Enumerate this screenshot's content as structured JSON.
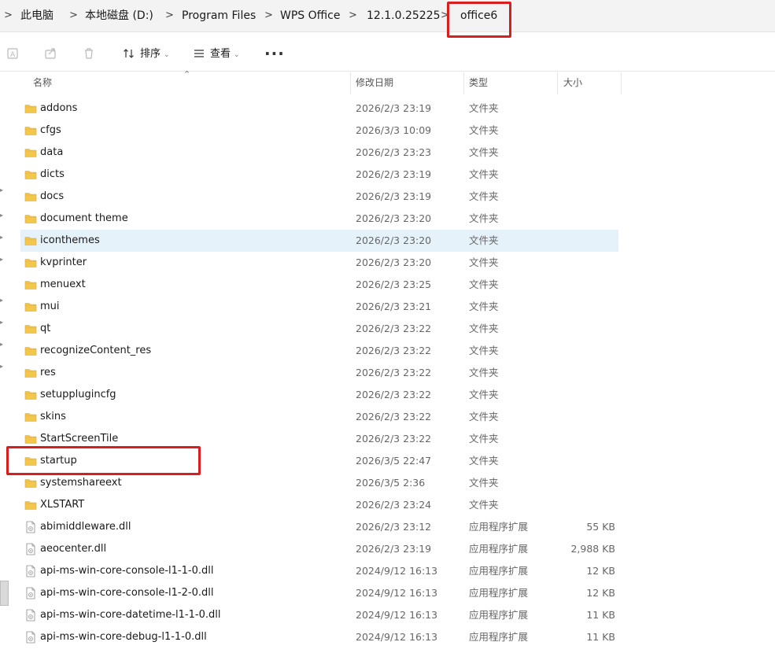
{
  "breadcrumb": {
    "items": [
      "此电脑",
      "本地磁盘 (D:)",
      "Program Files",
      "WPS Office",
      "12.1.0.25225",
      "office6"
    ],
    "separator": ">"
  },
  "toolbar": {
    "sort_label": "排序",
    "view_label": "查看",
    "more_label": "···"
  },
  "columns": {
    "name": "名称",
    "date": "修改日期",
    "type": "类型",
    "size": "大小"
  },
  "colors": {
    "highlight": "#d81e1e",
    "folder": "#f3c64c",
    "hover_row": "#e6f2fa"
  },
  "files": [
    {
      "name": "addons",
      "date": "2026/2/3 23:19",
      "type": "文件夹",
      "size": "",
      "icon": "folder-icon"
    },
    {
      "name": "cfgs",
      "date": "2026/3/3 10:09",
      "type": "文件夹",
      "size": "",
      "icon": "folder-icon"
    },
    {
      "name": "data",
      "date": "2026/2/3 23:23",
      "type": "文件夹",
      "size": "",
      "icon": "folder-icon"
    },
    {
      "name": "dicts",
      "date": "2026/2/3 23:19",
      "type": "文件夹",
      "size": "",
      "icon": "folder-icon"
    },
    {
      "name": "docs",
      "date": "2026/2/3 23:19",
      "type": "文件夹",
      "size": "",
      "icon": "folder-icon"
    },
    {
      "name": "document theme",
      "date": "2026/2/3 23:20",
      "type": "文件夹",
      "size": "",
      "icon": "folder-icon"
    },
    {
      "name": "iconthemes",
      "date": "2026/2/3 23:20",
      "type": "文件夹",
      "size": "",
      "icon": "folder-icon",
      "hover": true
    },
    {
      "name": "kvprinter",
      "date": "2026/2/3 23:20",
      "type": "文件夹",
      "size": "",
      "icon": "folder-icon"
    },
    {
      "name": "menuext",
      "date": "2026/2/3 23:25",
      "type": "文件夹",
      "size": "",
      "icon": "folder-icon"
    },
    {
      "name": "mui",
      "date": "2026/2/3 23:21",
      "type": "文件夹",
      "size": "",
      "icon": "folder-icon"
    },
    {
      "name": "qt",
      "date": "2026/2/3 23:22",
      "type": "文件夹",
      "size": "",
      "icon": "folder-icon"
    },
    {
      "name": "recognizeContent_res",
      "date": "2026/2/3 23:22",
      "type": "文件夹",
      "size": "",
      "icon": "folder-icon"
    },
    {
      "name": "res",
      "date": "2026/2/3 23:22",
      "type": "文件夹",
      "size": "",
      "icon": "folder-icon"
    },
    {
      "name": "setupplugincfg",
      "date": "2026/2/3 23:22",
      "type": "文件夹",
      "size": "",
      "icon": "folder-icon"
    },
    {
      "name": "skins",
      "date": "2026/2/3 23:22",
      "type": "文件夹",
      "size": "",
      "icon": "folder-icon"
    },
    {
      "name": "StartScreenTile",
      "date": "2026/2/3 23:22",
      "type": "文件夹",
      "size": "",
      "icon": "folder-icon"
    },
    {
      "name": "startup",
      "date": "2026/3/5 22:47",
      "type": "文件夹",
      "size": "",
      "icon": "folder-icon"
    },
    {
      "name": "systemshareext",
      "date": "2026/3/5 2:36",
      "type": "文件夹",
      "size": "",
      "icon": "folder-icon"
    },
    {
      "name": "XLSTART",
      "date": "2026/2/3 23:24",
      "type": "文件夹",
      "size": "",
      "icon": "folder-icon"
    },
    {
      "name": "abimiddleware.dll",
      "date": "2026/2/3 23:12",
      "type": "应用程序扩展",
      "size": "55 KB",
      "icon": "dll-file-icon"
    },
    {
      "name": "aeocenter.dll",
      "date": "2026/2/3 23:19",
      "type": "应用程序扩展",
      "size": "2,988 KB",
      "icon": "dll-file-icon"
    },
    {
      "name": "api-ms-win-core-console-l1-1-0.dll",
      "date": "2024/9/12 16:13",
      "type": "应用程序扩展",
      "size": "12 KB",
      "icon": "dll-file-icon"
    },
    {
      "name": "api-ms-win-core-console-l1-2-0.dll",
      "date": "2024/9/12 16:13",
      "type": "应用程序扩展",
      "size": "12 KB",
      "icon": "dll-file-icon"
    },
    {
      "name": "api-ms-win-core-datetime-l1-1-0.dll",
      "date": "2024/9/12 16:13",
      "type": "应用程序扩展",
      "size": "11 KB",
      "icon": "dll-file-icon"
    },
    {
      "name": "api-ms-win-core-debug-l1-1-0.dll",
      "date": "2024/9/12 16:13",
      "type": "应用程序扩展",
      "size": "11 KB",
      "icon": "dll-file-icon"
    }
  ]
}
